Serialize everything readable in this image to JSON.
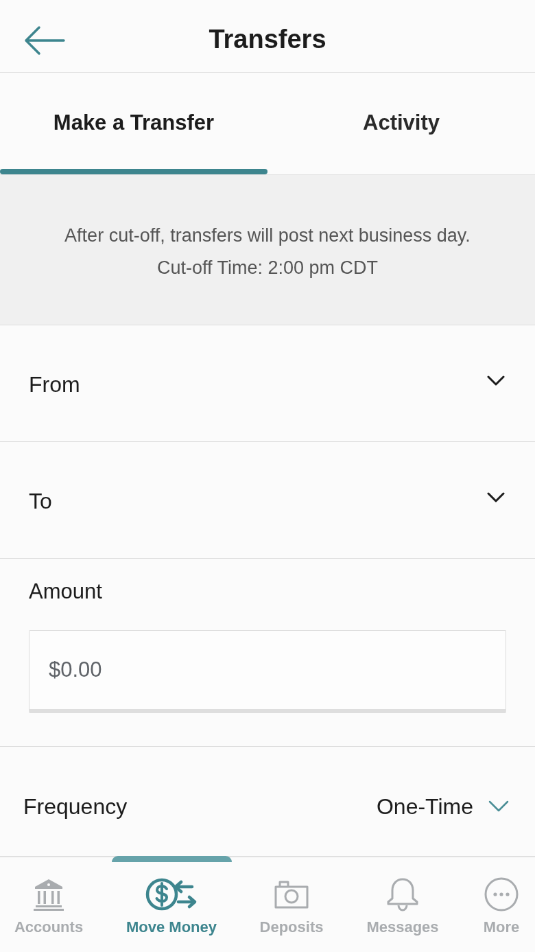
{
  "header": {
    "title": "Transfers"
  },
  "tabs": [
    {
      "label": "Make a Transfer",
      "selected": true
    },
    {
      "label": "Activity",
      "selected": false
    }
  ],
  "notice": {
    "lines": [
      "After cut-off, transfers will post next business day.",
      "Cut-off Time: 2:00 pm CDT"
    ]
  },
  "form": {
    "selects": [
      {
        "label": "From"
      },
      {
        "label": "To"
      }
    ],
    "amount": {
      "label": "Amount",
      "placeholder": "$0.00"
    },
    "frequency": {
      "label": "Frequency",
      "value": "One-Time"
    }
  },
  "bottom_nav": [
    {
      "label": "Accounts",
      "selected": false
    },
    {
      "label": "Move Money",
      "selected": true
    },
    {
      "label": "Deposits",
      "selected": false
    },
    {
      "label": "Messages",
      "selected": false
    },
    {
      "label": "More",
      "selected": false
    }
  ]
}
